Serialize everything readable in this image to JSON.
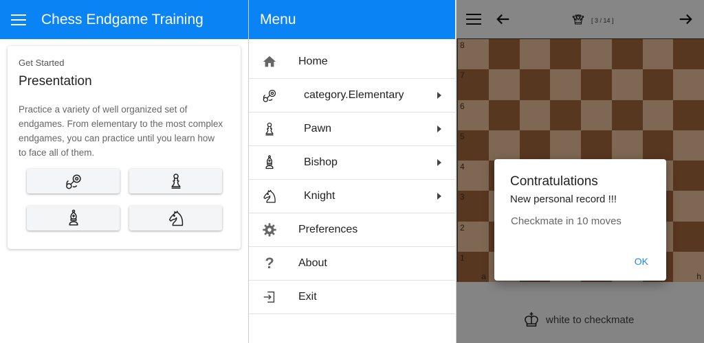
{
  "home": {
    "title": "Chess Endgame Training",
    "card": {
      "kicker": "Get Started",
      "heading": "Presentation",
      "description": "Practice a variety of well organized set of endgames. From elementary to the most complex endgames, you can practice until you learn how to face all of them.",
      "buttons": [
        "pacifier-icon",
        "pawn-icon",
        "bishop-icon",
        "knight-icon"
      ]
    }
  },
  "menu": {
    "title": "Menu",
    "items": [
      {
        "label": "Home",
        "icon": "home-icon",
        "submenu": false
      },
      {
        "label": "category.Elementary",
        "icon": "pacifier-icon",
        "submenu": true
      },
      {
        "label": "Pawn",
        "icon": "pawn-icon",
        "submenu": true
      },
      {
        "label": "Bishop",
        "icon": "bishop-icon",
        "submenu": true
      },
      {
        "label": "Knight",
        "icon": "knight-icon",
        "submenu": true
      },
      {
        "label": "Preferences",
        "icon": "gear-icon",
        "submenu": false
      },
      {
        "label": "About",
        "icon": "question-icon",
        "submenu": false
      },
      {
        "label": "Exit",
        "icon": "exit-icon",
        "submenu": false
      }
    ]
  },
  "game": {
    "counter": "[ 3 / 14 ]",
    "ranks": [
      "8",
      "7",
      "6",
      "5",
      "4",
      "3",
      "2",
      "1"
    ],
    "files": [
      "a",
      "h"
    ],
    "status": "white to checkmate",
    "dialog": {
      "title": "Contratulations",
      "subtitle": "New personal record !!!",
      "message": "Checkmate in 10 moves",
      "ok": "OK"
    }
  },
  "colors": {
    "appbar": "#0a83f5",
    "light_square": "#cba986",
    "dark_square": "#8e5a36",
    "accent": "#1c86f2"
  }
}
